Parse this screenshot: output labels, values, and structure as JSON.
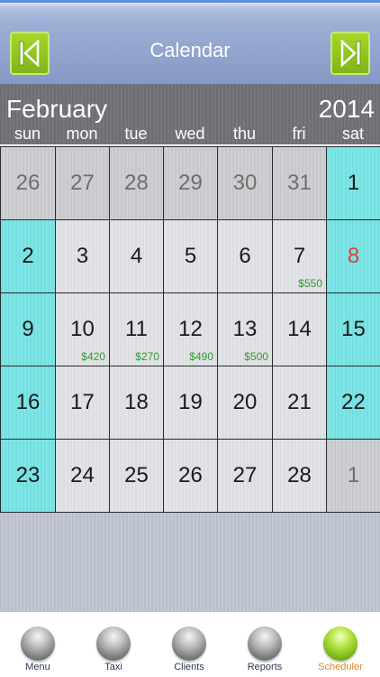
{
  "header": {
    "title": "Calendar",
    "prev_icon": "skip-back-icon",
    "next_icon": "skip-forward-icon"
  },
  "calendar": {
    "month": "February",
    "year": "2014",
    "weekdays": [
      "sun",
      "mon",
      "tue",
      "wed",
      "thu",
      "fri",
      "sat"
    ],
    "weeks": [
      [
        {
          "day": "26",
          "type": "other",
          "amount": ""
        },
        {
          "day": "27",
          "type": "other",
          "amount": ""
        },
        {
          "day": "28",
          "type": "other",
          "amount": ""
        },
        {
          "day": "29",
          "type": "other",
          "amount": ""
        },
        {
          "day": "30",
          "type": "other",
          "amount": ""
        },
        {
          "day": "31",
          "type": "other",
          "amount": ""
        },
        {
          "day": "1",
          "type": "weekend",
          "amount": ""
        }
      ],
      [
        {
          "day": "2",
          "type": "weekend",
          "amount": ""
        },
        {
          "day": "3",
          "type": "normal",
          "amount": ""
        },
        {
          "day": "4",
          "type": "normal",
          "amount": ""
        },
        {
          "day": "5",
          "type": "normal",
          "amount": ""
        },
        {
          "day": "6",
          "type": "normal",
          "amount": ""
        },
        {
          "day": "7",
          "type": "normal",
          "amount": "$550"
        },
        {
          "day": "8",
          "type": "weekend",
          "amount": "",
          "today": true
        }
      ],
      [
        {
          "day": "9",
          "type": "weekend",
          "amount": ""
        },
        {
          "day": "10",
          "type": "normal",
          "amount": "$420"
        },
        {
          "day": "11",
          "type": "normal",
          "amount": "$270"
        },
        {
          "day": "12",
          "type": "normal",
          "amount": "$490"
        },
        {
          "day": "13",
          "type": "normal",
          "amount": "$500"
        },
        {
          "day": "14",
          "type": "normal",
          "amount": ""
        },
        {
          "day": "15",
          "type": "weekend",
          "amount": ""
        }
      ],
      [
        {
          "day": "16",
          "type": "weekend",
          "amount": ""
        },
        {
          "day": "17",
          "type": "normal",
          "amount": ""
        },
        {
          "day": "18",
          "type": "normal",
          "amount": ""
        },
        {
          "day": "19",
          "type": "normal",
          "amount": ""
        },
        {
          "day": "20",
          "type": "normal",
          "amount": ""
        },
        {
          "day": "21",
          "type": "normal",
          "amount": ""
        },
        {
          "day": "22",
          "type": "weekend",
          "amount": ""
        }
      ],
      [
        {
          "day": "23",
          "type": "weekend",
          "amount": ""
        },
        {
          "day": "24",
          "type": "normal",
          "amount": ""
        },
        {
          "day": "25",
          "type": "normal",
          "amount": ""
        },
        {
          "day": "26",
          "type": "normal",
          "amount": ""
        },
        {
          "day": "27",
          "type": "normal",
          "amount": ""
        },
        {
          "day": "28",
          "type": "normal",
          "amount": ""
        },
        {
          "day": "1",
          "type": "other",
          "amount": ""
        }
      ]
    ]
  },
  "tabs": [
    {
      "label": "Menu",
      "icon": "menu-ball-icon",
      "active": false
    },
    {
      "label": "Taxi",
      "icon": "taxi-ball-icon",
      "active": false
    },
    {
      "label": "Clients",
      "icon": "clients-ball-icon",
      "active": false
    },
    {
      "label": "Reports",
      "icon": "reports-ball-icon",
      "active": false
    },
    {
      "label": "Scheduler",
      "icon": "scheduler-ball-icon",
      "active": true
    }
  ],
  "colors": {
    "accent_green": "#8cc21f",
    "weekend_cyan": "#7fe6e6",
    "today_red": "#e33b3b",
    "amount_green": "#2f9a2f",
    "active_tab_orange": "#e08a1e"
  }
}
